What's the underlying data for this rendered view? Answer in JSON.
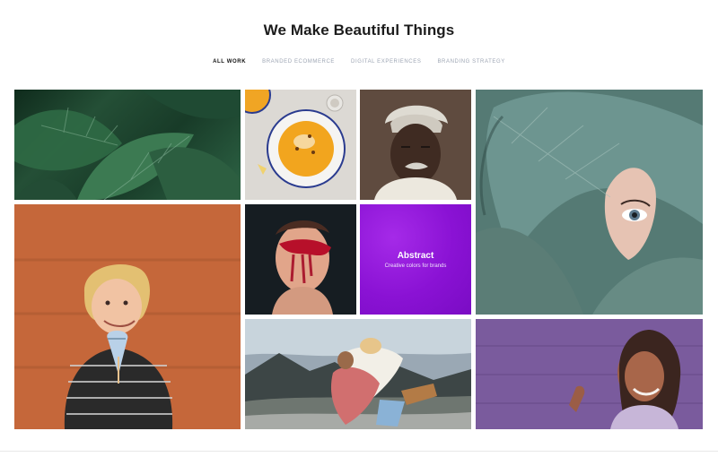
{
  "section": {
    "title": "We Make Beautiful Things"
  },
  "filters": [
    {
      "label": "ALL WORK",
      "active": true
    },
    {
      "label": "BRANDED ECOMMERCE",
      "active": false
    },
    {
      "label": "DIGITAL EXPERIENCES",
      "active": false
    },
    {
      "label": "BRANDING STRATEGY",
      "active": false
    }
  ],
  "portfolio": {
    "items": [
      {
        "subject": "tropical-leaves"
      },
      {
        "subject": "soup-bowl"
      },
      {
        "subject": "man-with-turban"
      },
      {
        "subject": "leaf-with-eye"
      },
      {
        "subject": "kid-with-ice-cream"
      },
      {
        "subject": "painted-face"
      },
      {
        "subject": "abstract-card",
        "title": "Abstract",
        "subtitle": "Creative colors for brands",
        "color": "#8a12d4"
      },
      {
        "subject": "couple-hug-mountains"
      },
      {
        "subject": "smiling-woman-purple-wall"
      }
    ]
  },
  "colors": {
    "accent_purple": "#8a12d4",
    "filter_inactive": "#9ea6b4",
    "filter_active": "#111111"
  }
}
